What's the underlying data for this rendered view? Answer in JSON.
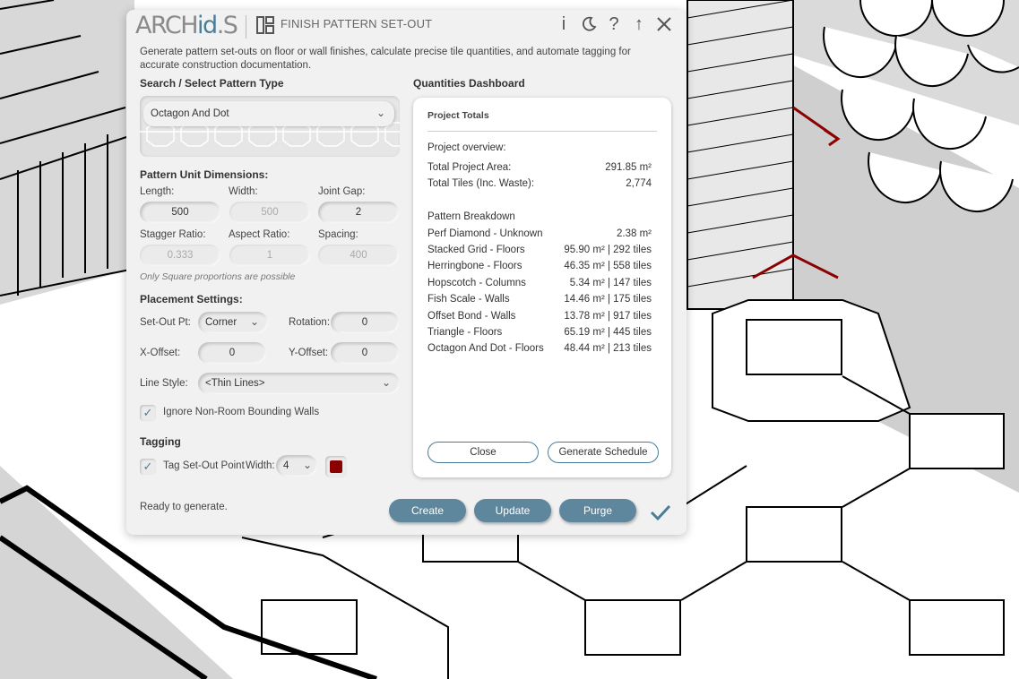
{
  "app": {
    "logo_text": "ARCH",
    "logo_accent": "id",
    "logo_end": "S",
    "title": "FINISH PATTERN SET-OUT",
    "header_icons": [
      "info-icon",
      "dark-mode-icon",
      "help-icon",
      "collapse-up-icon",
      "close-icon"
    ],
    "description": "Generate pattern set-outs on floor or wall finishes, calculate precise tile quantities, and automate tagging for accurate construction documentation."
  },
  "pattern": {
    "heading": "Search / Select Pattern Type",
    "selected": "Octagon And Dot"
  },
  "dimensions": {
    "heading": "Pattern Unit Dimensions:",
    "length_label": "Length:",
    "length": "500",
    "width_label": "Width:",
    "width": "500",
    "joint_label": "Joint Gap:",
    "joint": "2",
    "stagger_label": "Stagger Ratio:",
    "stagger": "0.333",
    "aspect_label": "Aspect Ratio:",
    "aspect": "1",
    "spacing_label": "Spacing:",
    "spacing": "400",
    "note": "Only Square proportions are possible"
  },
  "placement": {
    "heading": "Placement Settings:",
    "setout_label": "Set-Out Pt:",
    "setout": "Corner",
    "rotation_label": "Rotation:",
    "rotation": "0",
    "xoffset_label": "X-Offset:",
    "xoffset": "0",
    "yoffset_label": "Y-Offset:",
    "yoffset": "0",
    "linestyle_label": "Line Style:",
    "linestyle": "<Thin Lines>",
    "ignore_label": "Ignore Non-Room Bounding Walls",
    "ignore_checked": true
  },
  "tagging": {
    "heading": "Tagging",
    "tag_label": "Tag Set-Out Point",
    "tag_checked": true,
    "width_label": "Width:",
    "width": "4",
    "color": "#8b0000"
  },
  "dashboard": {
    "heading": "Quantities Dashboard",
    "panel_title": "Project Totals",
    "overview_label": "Project overview:",
    "area_label": "Total Project Area:",
    "area": "291.85 m²",
    "tiles_label": "Total Tiles (Inc. Waste):",
    "tiles": "2,774",
    "breakdown_label": "Pattern Breakdown",
    "breakdown": [
      {
        "name": "Perf Diamond - Unknown",
        "value": "2.38 m²"
      },
      {
        "name": "Stacked Grid - Floors",
        "value": "95.90 m²  |  292 tiles"
      },
      {
        "name": "Herringbone - Floors",
        "value": "46.35 m²  |  558 tiles"
      },
      {
        "name": "Hopscotch - Columns",
        "value": "5.34 m²  |  147 tiles"
      },
      {
        "name": "Fish Scale - Walls",
        "value": "14.46 m²  |  175 tiles"
      },
      {
        "name": "Offset Bond - Walls",
        "value": "13.78 m²  |  917 tiles"
      },
      {
        "name": "Triangle - Floors",
        "value": "65.19 m²  |  445 tiles"
      },
      {
        "name": "Octagon And Dot - Floors",
        "value": "48.44 m²  |  213 tiles"
      }
    ],
    "close_label": "Close",
    "schedule_label": "Generate Schedule"
  },
  "footer": {
    "status": "Ready to generate.",
    "create_label": "Create",
    "update_label": "Update",
    "purge_label": "Purge"
  },
  "colors": {
    "accent": "#4b7c98",
    "button": "#5e879e",
    "tag_red": "#8b0000"
  }
}
